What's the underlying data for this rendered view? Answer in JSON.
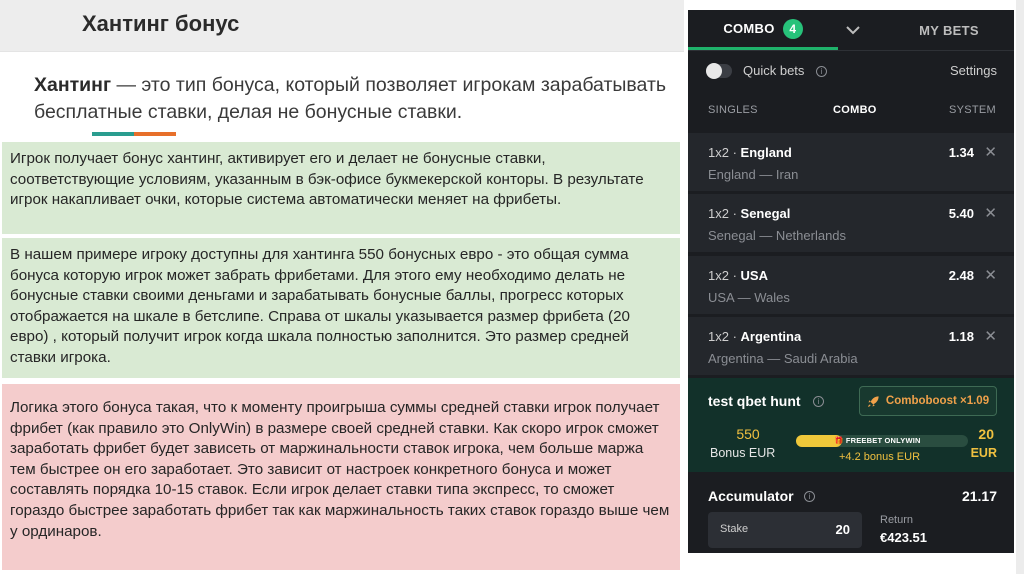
{
  "slide": {
    "title": "Хантинг бонус",
    "intro_term": "Хантинг",
    "intro_rest": " — это тип бонуса, который позволяет игрокам зарабатывать бесплатные ставки, делая не бонусные ставки.",
    "box1": "Игрок получает бонус хантинг, активирует его и делает не бонусные ставки, соответствующие условиям, указанным в бэк-офисе букмекерской конторы. В результате игрок накапливает очки, которые система автоматически меняет на фрибеты.",
    "box2": "В нашем примере игроку доступны для хантинга 550 бонусных евро - это общая сумма бонуса которую игрок может забрать фрибетами. Для этого ему необходимо делать не бонусные ставки своими деньгами и зарабатывать бонусные баллы, прогресс которых отображается на шкале в бетслипе. Справа от шкалы указывается размер фрибета (20 евро) , который получит игрок когда шкала полностью заполнится. Это размер средней ставки игрока.",
    "box3": "Логика этого бонуса такая, что к моменту проигрыша суммы средней ставки игрок получает фрибет (как правило это OnlyWin) в размере своей средней ставки. Как скоро игрок сможет заработать фрибет будет зависеть от маржинальности ставок игрока, чем больше маржа тем быстрее он его заработает. Это зависит от настроек конкретного бонуса и может составлять порядка 10-15 ставок. Если игрок делает ставки типа экспресс, то сможет гораздо быстрее заработать фрибет так как маржинальность таких ставок гораздо выше чем у ординаров."
  },
  "betslip": {
    "tabs": {
      "combo": "COMBO",
      "combo_count": "4",
      "my_bets": "MY BETS"
    },
    "quick_bets": "Quick bets",
    "settings": "Settings",
    "subtabs": {
      "singles": "SINGLES",
      "combo": "COMBO",
      "system": "SYSTEM"
    },
    "bets": [
      {
        "market": "1x2",
        "pick": "England",
        "match": "England — Iran",
        "odd": "1.34"
      },
      {
        "market": "1x2",
        "pick": "Senegal",
        "match": "Senegal — Netherlands",
        "odd": "5.40"
      },
      {
        "market": "1x2",
        "pick": "USA",
        "match": "USA — Wales",
        "odd": "2.48"
      },
      {
        "market": "1x2",
        "pick": "Argentina",
        "match": "Argentina — Saudi Arabia",
        "odd": "1.18"
      }
    ],
    "remove_symbol": "✕",
    "hunt": {
      "title": "test qbet hunt",
      "comboboost": "Comboboost ×1.09",
      "bonus_amount": "550",
      "bonus_currency": "Bonus EUR",
      "bar_label": "FREEBET ONLYWIN",
      "bar_progress": 0.27,
      "bar_sub": "+4.2 bonus EUR",
      "freebet_amount": "20",
      "freebet_currency": "EUR"
    },
    "accumulator": {
      "title": "Accumulator",
      "odds": "21.17",
      "stake_label": "Stake",
      "stake_value": "20",
      "return_label": "Return",
      "return_value": "€423.51"
    },
    "colors": {
      "accent_green": "#27c27a",
      "panel_bg": "#1b1d21",
      "hunt_bg": "#12312a",
      "gold": "#f0c040",
      "orange": "#f0a14a"
    }
  }
}
